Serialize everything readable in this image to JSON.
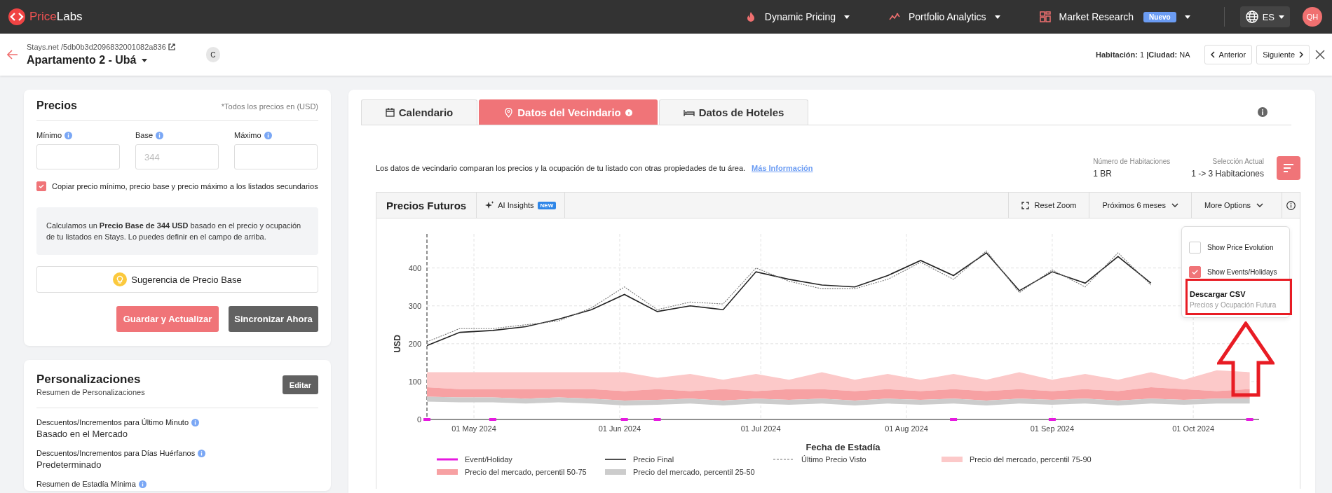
{
  "navbar": {
    "logo_prefix": "Price",
    "logo_suffix": "Labs",
    "menus": [
      {
        "label": "Dynamic Pricing"
      },
      {
        "label": "Portfolio Analytics"
      },
      {
        "label": "Market Research",
        "badge": "Nuevo"
      }
    ],
    "language": "ES",
    "avatar": "QH"
  },
  "listing_header": {
    "breadcrumb": "Stays.net /5db0b3d2096832001082a836",
    "title": "Apartamento 2 - Ubá",
    "tag": "C",
    "room_label": "Habitación:",
    "room_value": "1",
    "city_label": "|Ciudad:",
    "city_value": "NA",
    "prev": "Anterior",
    "next": "Siguiente"
  },
  "prices_card": {
    "title": "Precios",
    "note": "*Todos los precios en (USD)",
    "fields": [
      {
        "label": "Mínimo"
      },
      {
        "label": "Base",
        "placeholder": "344"
      },
      {
        "label": "Máximo"
      }
    ],
    "copy_option": {
      "label": "Copiar precio mínimo, precio base y precio máximo a los listados secundarios",
      "checked": true
    },
    "info": "Calculamos un **Precio Base de 344 USD** basado en el precio y ocupación de tu listados en Stays. Lo puedes definir en el campo de arriba.",
    "suggestion_button": "Sugerencia de Precio Base",
    "save_button": "Guardar y Actualizar",
    "sync_button": "Sincronizar Ahora"
  },
  "customizations_card": {
    "title": "Personalizaciones",
    "subtitle": "Resumen de Personalizaciones",
    "edit_button": "Editar",
    "items": [
      {
        "label": "Descuentos/Incrementos para Último Minuto",
        "value": "Basado en el Mercado"
      },
      {
        "label": "Descuentos/Incrementos para Días Huérfanos",
        "value": "Predeterminado"
      },
      {
        "label": "Resumen de Estadía Mínima"
      }
    ]
  },
  "tabs": [
    {
      "label": "Calendario",
      "selected": false
    },
    {
      "label": "Datos del Vecindario",
      "selected": true
    },
    {
      "label": "Datos de Hoteles",
      "selected": false
    }
  ],
  "neighborhood": {
    "description": "Los datos de vecindario comparan los precios y la ocupación de tu listado con otras propiedades de tu área.",
    "link": "Más Información",
    "stats": [
      {
        "label": "Número de Habitaciones",
        "value": "1 BR"
      },
      {
        "label": "Selección Actual",
        "value": "1 -> 3 Habitaciones"
      }
    ],
    "chart_panel": {
      "title": "Precios Futuros",
      "ai_label": "AI Insights",
      "ai_badge": "NEW",
      "reset_zoom": "Reset Zoom",
      "range": "Próximos 6 meses",
      "more_options": "More Options",
      "options_menu": {
        "options": [
          {
            "label": "Show Price Evolution",
            "checked": false
          },
          {
            "label": "Show Events/Holidays",
            "checked": true
          }
        ],
        "download_title": "Descargar CSV",
        "download_subtitle": "Precios y Ocupación Futura"
      },
      "chart_data": {
        "type": "line",
        "xlabel": "Fecha de Estadía",
        "ylabel": "USD",
        "x": [
          "2024-04-21",
          "2024-04-28",
          "2024-05-05",
          "2024-05-12",
          "2024-05-19",
          "2024-05-26",
          "2024-06-02",
          "2024-06-09",
          "2024-06-16",
          "2024-06-23",
          "2024-06-30",
          "2024-07-07",
          "2024-07-14",
          "2024-07-21",
          "2024-07-28",
          "2024-08-04",
          "2024-08-11",
          "2024-08-18",
          "2024-08-25",
          "2024-09-01",
          "2024-09-08",
          "2024-09-15",
          "2024-09-22",
          "2024-09-29",
          "2024-10-06",
          "2024-10-13"
        ],
        "xlim": [
          "2024-04-21",
          "2024-10-15"
        ],
        "ylim": [
          0,
          490
        ],
        "xticks": [
          {
            "value": "2024-05-01",
            "label": "01 May 2024"
          },
          {
            "value": "2024-06-01",
            "label": "01 Jun 2024"
          },
          {
            "value": "2024-07-01",
            "label": "01 Jul 2024"
          },
          {
            "value": "2024-08-01",
            "label": "01 Aug 2024"
          },
          {
            "value": "2024-09-01",
            "label": "01 Sep 2024"
          },
          {
            "value": "2024-10-01",
            "label": "01 Oct 2024"
          }
        ],
        "yticks": [
          0,
          100,
          200,
          300,
          400
        ],
        "grid": true,
        "series": [
          {
            "name": "Event/Holiday",
            "type": "scatter",
            "color": "#e619e0",
            "values": [
              0,
              null,
              0,
              null,
              null,
              null,
              0,
              0,
              null,
              null,
              null,
              null,
              null,
              null,
              null,
              null,
              0,
              null,
              null,
              0,
              null,
              null,
              null,
              null,
              null,
              0
            ]
          },
          {
            "name": "Precio Final",
            "type": "line",
            "color": "#222222",
            "values": [
              195,
              230,
              235,
              245,
              265,
              290,
              330,
              285,
              300,
              290,
              390,
              370,
              355,
              350,
              380,
              420,
              380,
              440,
              340,
              390,
              360,
              430,
              360,
              null,
              null,
              null
            ]
          },
          {
            "name": "Último Precio Visto",
            "type": "line",
            "line_style": "dashed",
            "color": "#777777",
            "values": [
              205,
              240,
              240,
              250,
              260,
              295,
              350,
              290,
              310,
              305,
              400,
              365,
              345,
              345,
              370,
              415,
              370,
              445,
              335,
              395,
              350,
              440,
              355,
              null,
              null,
              null
            ]
          },
          {
            "name": "Precio del mercado, percentil 75-90",
            "type": "area",
            "color": "#fcc9c9",
            "values": [
              125,
              125,
              125,
              125,
              125,
              125,
              125,
              110,
              120,
              105,
              120,
              105,
              125,
              105,
              120,
              105,
              120,
              105,
              125,
              105,
              120,
              105,
              125,
              105,
              130,
              125
            ]
          },
          {
            "name": "Precio del mercado, percentil 50-75",
            "type": "area",
            "color": "#f7a1a3",
            "values": [
              85,
              80,
              80,
              80,
              80,
              80,
              75,
              80,
              75,
              80,
              75,
              80,
              80,
              75,
              80,
              75,
              80,
              75,
              80,
              75,
              80,
              75,
              85,
              80,
              75,
              80
            ]
          },
          {
            "name": "Precio del mercado, percentil 25-50",
            "type": "area",
            "color": "#cccccc",
            "values": [
              60,
              58,
              58,
              55,
              58,
              55,
              50,
              52,
              55,
              50,
              55,
              52,
              55,
              50,
              55,
              52,
              55,
              50,
              55,
              52,
              55,
              50,
              55,
              52,
              55,
              55
            ]
          }
        ]
      }
    }
  }
}
